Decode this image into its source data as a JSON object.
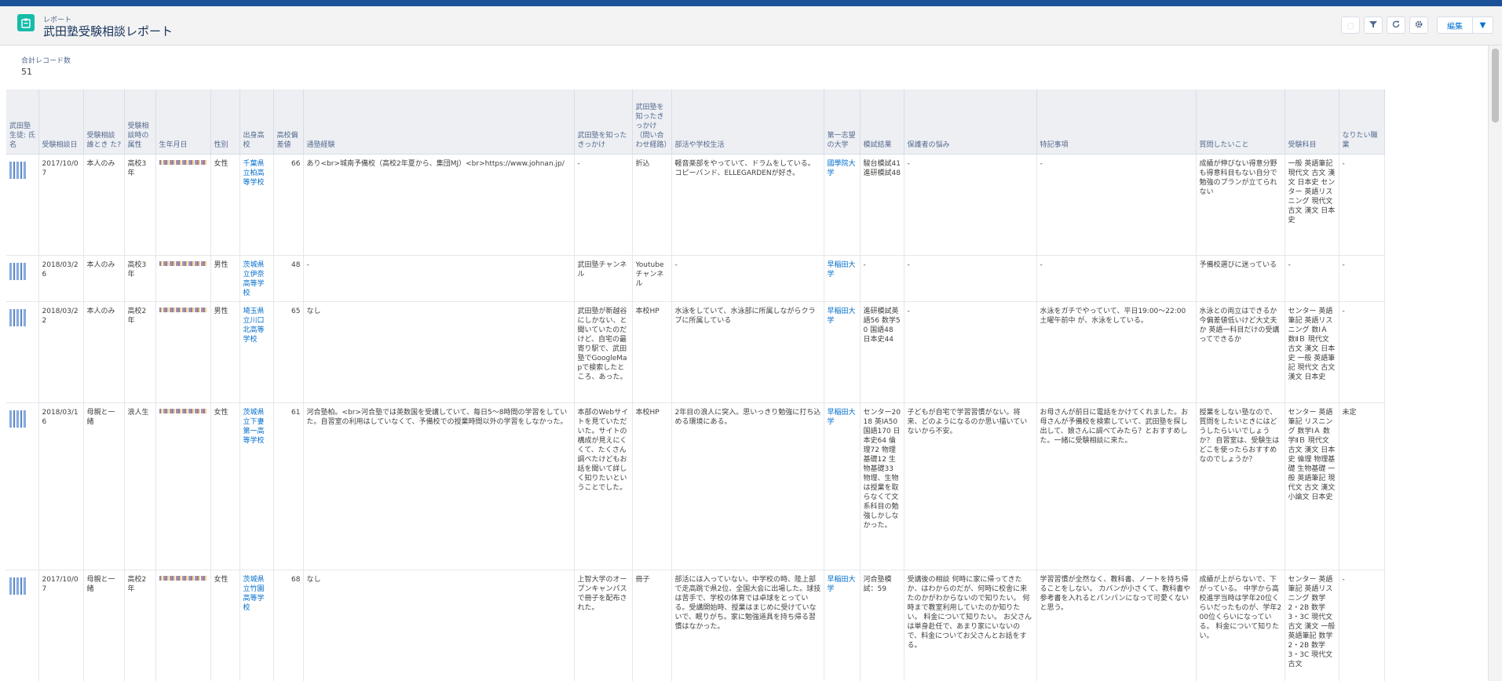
{
  "header": {
    "eyebrow": "レポート",
    "title": "武田塾受験相談レポート",
    "edit_label": "編集"
  },
  "summary": {
    "label": "合計レコード数",
    "value": "51"
  },
  "table": {
    "columns": [
      "武田塾生徒: 氏名",
      "受験相談日",
      "受験相談誰とき た?",
      "受験相談時の 属性",
      "生年月日",
      "性別",
      "出身高校",
      "高校偏 差値",
      "通塾経験",
      "武田塾を知ったきっかけ",
      "武田塾を知ったきっかけ（問い合わせ経路）",
      "部活や学校生活",
      "第一志望の大学",
      "模試結果",
      "保護者の悩み",
      "特記事項",
      "質問したいこと",
      "受験科目",
      "なりたい職業"
    ],
    "rows": [
      {
        "date": "2017/10/07",
        "with": "本人のみ",
        "attr": "高校3年",
        "gender": "女性",
        "school": "千葉県立柏高等学校",
        "dev": "66",
        "cram": "あり<br>城南予備校（高校2年夏から、集団MJ）<br>https://www.johnan.jp/",
        "know": "-",
        "route": "折込",
        "club": "軽音楽部をやっていて、ドラムをしている。コピーバンド、ELLEGARDENが好き。",
        "univ": "國學院大学",
        "mock": "駿台模試41 進研模試48",
        "parent": "-",
        "notes": "-",
        "question": "成績が伸びない得意分野も得意科目もない自分で勉強のプランが立てられない",
        "subjects": "一般 英語筆記 現代文 古文 漢文 日本史 センター 英語リスニング 現代文 古文 漢文 日本史",
        "job": "-"
      },
      {
        "date": "2018/03/26",
        "with": "本人のみ",
        "attr": "高校3年",
        "gender": "男性",
        "school": "茨城県立伊奈高等学校",
        "dev": "48",
        "cram": "-",
        "know": "武田塾チャンネル",
        "route": "Youtubeチャンネル",
        "club": "-",
        "univ": "早稲田大学",
        "mock": "-",
        "parent": "-",
        "notes": "-",
        "question": "予備校選びに迷っている",
        "subjects": "-",
        "job": "-"
      },
      {
        "date": "2018/03/22",
        "with": "本人のみ",
        "attr": "高校2年",
        "gender": "男性",
        "school": "埼玉県立川口北高等学校",
        "dev": "65",
        "cram": "なし",
        "know": "武田塾が新越谷にしかない、と聞いていたのだけど、自宅の最寄り駅で、武田塾でGoogleMapで検索したところ、あった。",
        "route": "本校HP",
        "club": "水泳をしていて、水泳部に所属しながらクラブに所属している",
        "univ": "早稲田大学",
        "mock": "進研模試英語56 数学50 国語48 日本史44",
        "parent": "-",
        "notes": "水泳をガチでやっていて、平日19:00～22:00 土曜午前中 が、水泳をしている。",
        "question": "水泳との両立はできるか 今偏差値低いけど大丈夫か 英語一科目だけの受講ってできるか",
        "subjects": "センター 英語筆記 英語リスニング 数ⅠＡ 数ⅡＢ 現代文 古文 漢文 日本史 一般 英語筆記 現代文 古文 漢文 日本史",
        "job": "-"
      },
      {
        "date": "2018/03/16",
        "with": "母親と一緒",
        "attr": "浪人生",
        "gender": "女性",
        "school": "茨城県立下妻第一高等学校",
        "dev": "61",
        "cram": "河合塾柏。<br>河合塾では英数国を受講していて、毎日5～8時間の学習をしていた。自習室の利用はしていなくて、予備校での授業時間以外の学習をしなかった。",
        "know": "本部のWebサイトを見ていただいた。サイトの構成が見えにくくて、たくさん調べたけどもお話を聞いて詳しく知りたいということでした。",
        "route": "本校HP",
        "club": "2年目の浪人に突入。思いっきり勉強に打ち込める環境にある。",
        "univ": "早稲田大学",
        "mock": "センター2018 英ⅠA50 国語170 日本史64 倫理72 物理基礎12 生物基礎33 物理、生物は授業を取らなくて文系科目の勉強しかしなかった。",
        "parent": "子どもが自宅で学習習慣がない。将来、どのようになるのか思い描いていないから不安。",
        "notes": "お母さんが前日に電話をかけてくれました。お母さんが予備校を検索していて、武田塾を探し出して、娘さんに調べてみたら？とおすすめした。一緒に受験相談に来た。",
        "question": "授業をしない塾なので、質問をしたいときにはどうしたらいいでしょうか？ 自習室は、受験生はどこを使ったらおすすめなのでしょうか？",
        "subjects": "センター 英語筆記 リスニング 数学ⅠＡ 数学ⅡＢ 現代文 古文 漢文 日本史 倫理 物理基礎 生物基礎 一般 英語筆記 現代文 古文 漢文 小論文 日本史",
        "job": "未定"
      },
      {
        "date": "2017/10/07",
        "with": "母親と一緒",
        "attr": "高校2年",
        "gender": "女性",
        "school": "茨城県立竹園高等学校",
        "dev": "68",
        "cram": "なし",
        "know": "上智大学のオープンキャンパスで冊子を配布された。",
        "route": "冊子",
        "club": "部活には入っていない。中学校の時、陸上部で走高跳で県2位、全国大会に出場した。球技は苦手で、学校の体育では卓球をとっている。受講開始時、授業はまじめに受けていないで、眠りがち。家に勉強道具を持ち帰る習慣はなかった。",
        "univ": "早稲田大学",
        "mock": "河合塾模試：59",
        "parent": "受講後の相談 何時に家に帰ってきたか、はわからのだが、何時に校舎に来たのかがわからないので知りたい。 何時まで教室利用していたのか知りたい。 料金について知りたい。 お父さんは単身赴任で、あまり家にいないので、料金についてお父さんとお話をする。",
        "notes": "学習習慣が全然なく、教科書、ノートを持ち帰ることをしない。 カバンが小さくて、教科書や参考書を入れるとパンパンになって可愛くないと思う。",
        "question": "成績が上がらないで、下がっている。 中学から高校進学当時は学年20位くらいだったものが、学年200位くらいになっている。 料金について知りたい。",
        "subjects": "センター 英語筆記 英語リスニング 数学2・2B 数学3・3C 現代文 古文 漢文 一般 英語筆記 数学2・2B 数学3・3C 現代文 古文",
        "job": "-"
      }
    ]
  },
  "icons": {
    "app": "report-icon",
    "toolbar": [
      "ai-icon",
      "filter-icon",
      "refresh-icon",
      "gear-icon",
      "chevron-down-icon"
    ]
  },
  "colors": {
    "link": "#006dcc",
    "brand_bar": "#1b5297",
    "app_icon": "#15bca9"
  }
}
